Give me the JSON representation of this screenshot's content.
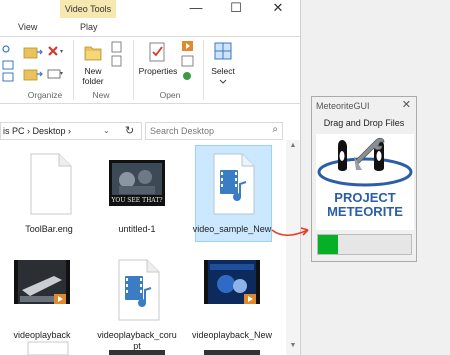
{
  "explorer": {
    "context_tab": "Video Tools",
    "tabs": [
      {
        "label": "View"
      },
      {
        "label": "Play"
      }
    ],
    "window_controls": {
      "minimize": "—",
      "maximize": "☐",
      "close": "✕"
    },
    "ribbon": {
      "organize": {
        "label": "Organize"
      },
      "new": {
        "label": "New",
        "new_folder_label": "New folder"
      },
      "open": {
        "label": "Open",
        "properties_label": "Properties"
      },
      "select": {
        "select_label": "Select"
      }
    },
    "address": {
      "path": "is PC  ›  Desktop  ›",
      "chevron": "⌄",
      "refresh": "↻"
    },
    "search": {
      "placeholder": "Search Desktop",
      "icon": "⌕"
    },
    "files": [
      {
        "name": "ToolBar.eng",
        "type": "document"
      },
      {
        "name": "untitled-1",
        "type": "image"
      },
      {
        "name": "video_sample_New",
        "type": "audio-video",
        "selected": true
      },
      {
        "name": "videoplayback",
        "type": "video"
      },
      {
        "name": "videoplayback_corupt",
        "type": "audio-video"
      },
      {
        "name": "videoplayback_New",
        "type": "video"
      }
    ],
    "thumbnail_caption": "YOU SEE THAT?"
  },
  "meteorite": {
    "title": "MeteoriteGUI",
    "close": "✕",
    "hint": "Drag and Drop Files",
    "logo_line1": "PROJECT",
    "logo_line2": "METEORITE",
    "progress_fraction": 0.22,
    "accent": "#06b025",
    "logo_color": "#2b5ea8"
  },
  "annotation": {
    "color": "#e2402a"
  }
}
